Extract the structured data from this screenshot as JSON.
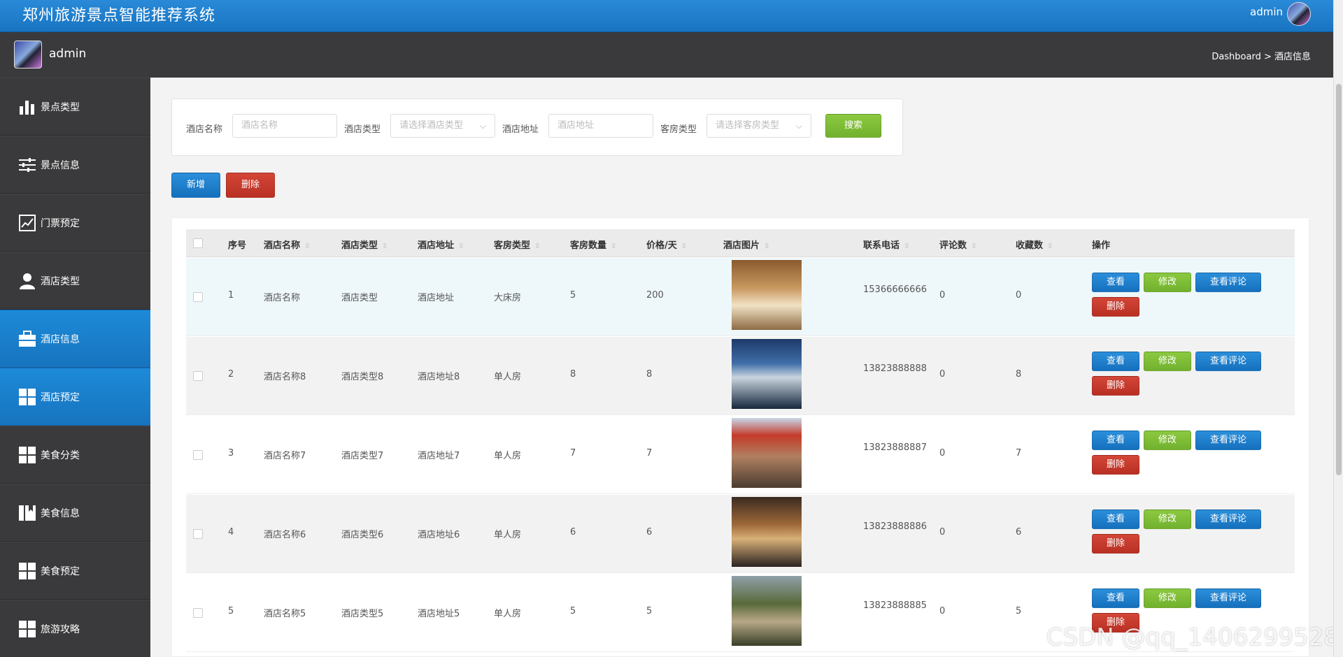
{
  "app": {
    "title": "郑州旅游景点智能推荐系统",
    "user": "admin"
  },
  "secbar": {
    "name": "admin",
    "breadcrumb": "Dashboard > 酒店信息"
  },
  "sidebar": {
    "items": [
      {
        "label": "景点类型",
        "icon": "bar-chart-icon"
      },
      {
        "label": "景点信息",
        "icon": "sliders-icon"
      },
      {
        "label": "门票预定",
        "icon": "line-chart-icon"
      },
      {
        "label": "酒店类型",
        "icon": "user-icon"
      },
      {
        "label": "酒店信息",
        "icon": "briefcase-icon",
        "active": true
      },
      {
        "label": "酒店预定",
        "icon": "grid-icon",
        "active": true
      },
      {
        "label": "美食分类",
        "icon": "grid-icon"
      },
      {
        "label": "美食信息",
        "icon": "book-icon"
      },
      {
        "label": "美食预定",
        "icon": "grid-icon"
      },
      {
        "label": "旅游攻略",
        "icon": "grid-icon"
      }
    ]
  },
  "search": {
    "name_label": "酒店名称",
    "name_placeholder": "酒店名称",
    "type_label": "酒店类型",
    "type_placeholder": "请选择酒店类型",
    "addr_label": "酒店地址",
    "addr_placeholder": "酒店地址",
    "room_label": "客房类型",
    "room_placeholder": "请选择客房类型",
    "search_button": "搜索"
  },
  "actions": {
    "add": "新增",
    "delete": "删除"
  },
  "table": {
    "headers": [
      "序号",
      "酒店名称",
      "酒店类型",
      "酒店地址",
      "客房类型",
      "客房数量",
      "价格/天",
      "酒店图片",
      "联系电话",
      "评论数",
      "收藏数",
      "操作"
    ],
    "rows": [
      {
        "no": "1",
        "name": "酒店名称",
        "type": "酒店类型",
        "addr": "酒店地址",
        "room": "大床房",
        "count": "5",
        "price": "200",
        "phone": "15366666666",
        "comments": "0",
        "favs": "0"
      },
      {
        "no": "2",
        "name": "酒店名称8",
        "type": "酒店类型8",
        "addr": "酒店地址8",
        "room": "单人房",
        "count": "8",
        "price": "8",
        "phone": "13823888888",
        "comments": "0",
        "favs": "8"
      },
      {
        "no": "3",
        "name": "酒店名称7",
        "type": "酒店类型7",
        "addr": "酒店地址7",
        "room": "单人房",
        "count": "7",
        "price": "7",
        "phone": "13823888887",
        "comments": "0",
        "favs": "7"
      },
      {
        "no": "4",
        "name": "酒店名称6",
        "type": "酒店类型6",
        "addr": "酒店地址6",
        "room": "单人房",
        "count": "6",
        "price": "6",
        "phone": "13823888886",
        "comments": "0",
        "favs": "6"
      },
      {
        "no": "5",
        "name": "酒店名称5",
        "type": "酒店类型5",
        "addr": "酒店地址5",
        "room": "单人房",
        "count": "5",
        "price": "5",
        "phone": "13823888885",
        "comments": "0",
        "favs": "5"
      }
    ],
    "row_buttons": {
      "view": "查看",
      "edit": "修改",
      "comments": "查看评论",
      "delete": "删除"
    }
  },
  "watermark": "CSDN @qq_1406299528",
  "colors": {
    "primary": "#1d7ccb",
    "success": "#7cbd35",
    "danger": "#c23a2c",
    "sidebar": "#3a3a3c"
  }
}
